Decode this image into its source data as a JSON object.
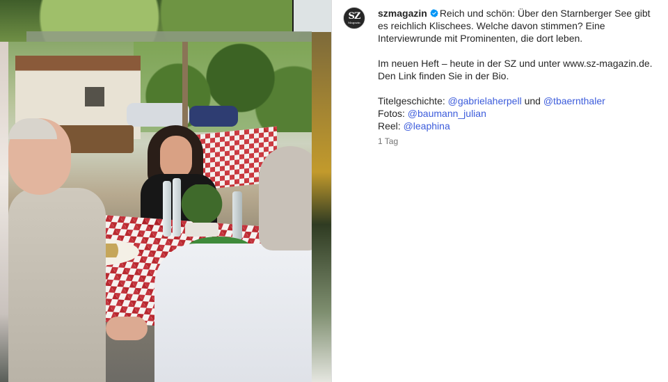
{
  "post": {
    "username": "szmagazin",
    "avatar": {
      "line1": "SZ",
      "line2": "Magazin"
    },
    "caption_intro": "Reich und schön: Über den Starnberger See gibt es reichlich Klischees. Welche davon stimmen? Eine Interviewrunde mit Prominenten, die dort leben.",
    "caption_paragraph2": "Im neuen Heft – heute in der SZ und unter www.sz-magazin.de. Den Link finden Sie in der Bio.",
    "credits": {
      "title_label": "Titelgeschichte: ",
      "title_mention1": "@gabrielaherpell",
      "title_joiner": " und ",
      "title_mention2": "@tbaernthaler",
      "photos_label": "Fotos: ",
      "photos_mention": "@baumann_julian",
      "reel_label": "Reel: ",
      "reel_mention": "@leaphina"
    },
    "timestamp": "1 Tag"
  },
  "icons": {
    "verified": "verified-badge-icon"
  },
  "colors": {
    "text": "#262626",
    "link": "#3b5bdb",
    "muted": "#737373",
    "verified": "#0095f6",
    "divider": "#dbdbdb"
  }
}
